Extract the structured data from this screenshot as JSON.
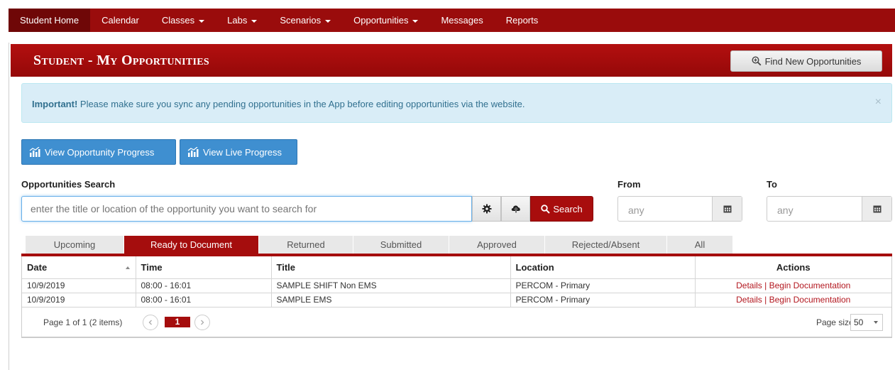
{
  "nav": {
    "items": [
      {
        "label": "Student Home",
        "dropdown": false,
        "active": true
      },
      {
        "label": "Calendar",
        "dropdown": false,
        "active": false
      },
      {
        "label": "Classes",
        "dropdown": true,
        "active": false
      },
      {
        "label": "Labs",
        "dropdown": true,
        "active": false
      },
      {
        "label": "Scenarios",
        "dropdown": true,
        "active": false
      },
      {
        "label": "Opportunities",
        "dropdown": true,
        "active": false
      },
      {
        "label": "Messages",
        "dropdown": false,
        "active": false
      },
      {
        "label": "Reports",
        "dropdown": false,
        "active": false
      }
    ]
  },
  "header": {
    "title": "Student - My Opportunities",
    "find_button": "Find New Opportunities"
  },
  "alert": {
    "strong": "Important!",
    "text": " Please make sure you sync any pending opportunities in the App before editing opportunities via the website.",
    "close": "×"
  },
  "progress_buttons": {
    "opportunity": "View Opportunity Progress",
    "live": "View Live Progress"
  },
  "search": {
    "label": "Opportunities Search",
    "placeholder": "enter the title or location of the opportunity you want to search for",
    "button": "Search"
  },
  "from": {
    "label": "From",
    "placeholder": "any"
  },
  "to": {
    "label": "To",
    "placeholder": "any"
  },
  "tabs": [
    {
      "label": "Upcoming",
      "active": false
    },
    {
      "label": "Ready to Document",
      "active": true
    },
    {
      "label": "Returned",
      "active": false
    },
    {
      "label": "Submitted",
      "active": false
    },
    {
      "label": "Approved",
      "active": false
    },
    {
      "label": "Rejected/Absent",
      "active": false
    },
    {
      "label": "All",
      "active": false
    }
  ],
  "grid": {
    "columns": [
      "Date",
      "Time",
      "Title",
      "Location",
      "Actions"
    ],
    "rows": [
      {
        "date": "10/9/2019",
        "time": "08:00 - 16:01",
        "title": "SAMPLE SHIFT Non EMS",
        "location": "PERCOM - Primary",
        "details": "Details",
        "sep": " | ",
        "begin": "Begin Documentation"
      },
      {
        "date": "10/9/2019",
        "time": "08:00 - 16:01",
        "title": "SAMPLE EMS",
        "location": "PERCOM - Primary",
        "details": "Details",
        "sep": " | ",
        "begin": "Begin Documentation"
      }
    ]
  },
  "pager": {
    "summary": "Page 1 of 1 (2 items)",
    "current": "1",
    "page_size_label": "Page size:",
    "page_size": "50"
  },
  "colors": {
    "brand_red": "#a50d0d",
    "nav_red": "#9a0c0c",
    "info_bg": "#d9edf7",
    "button_blue": "#3f8fd0"
  }
}
